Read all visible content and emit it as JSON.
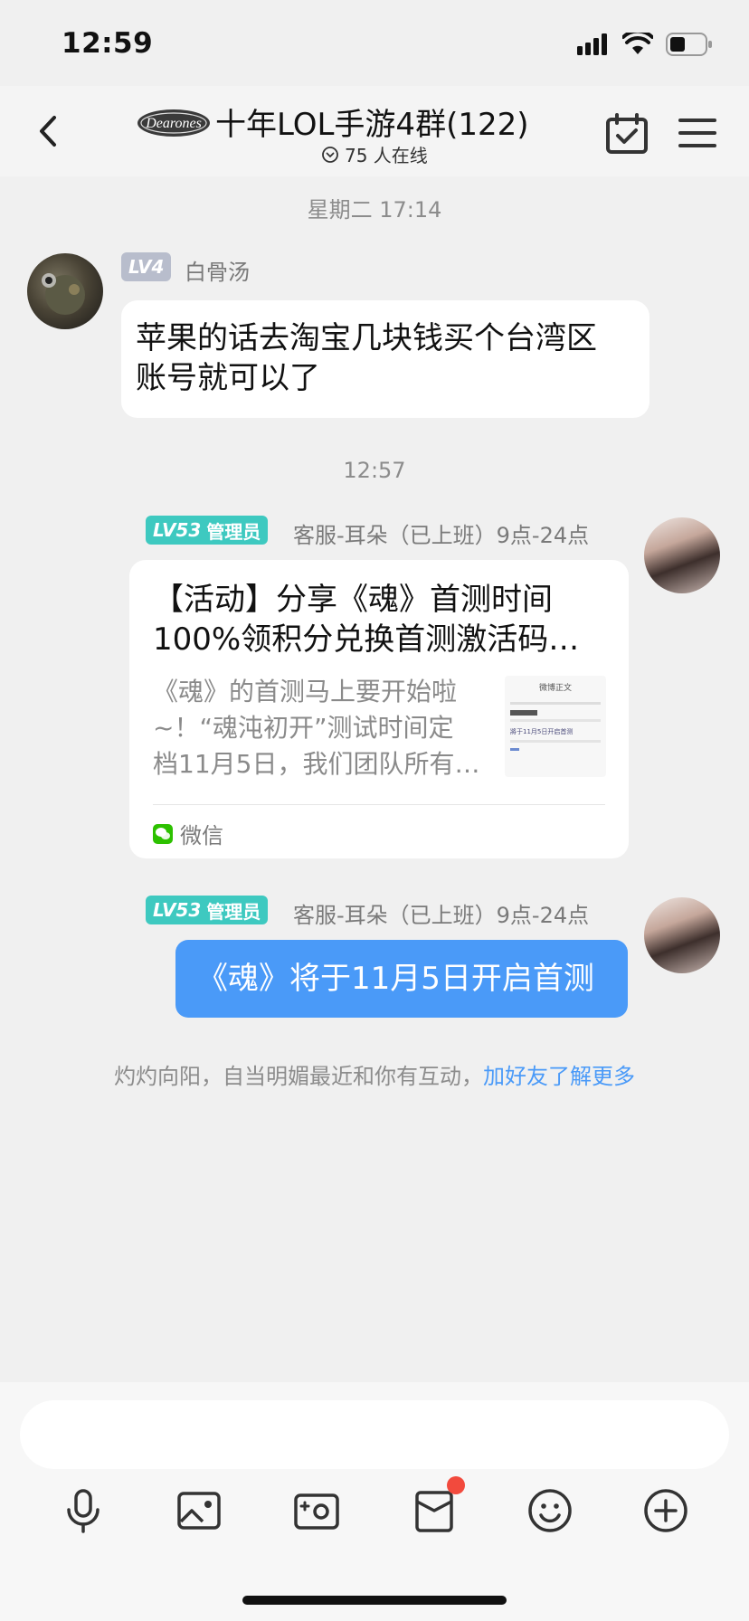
{
  "status_bar": {
    "time": "12:59"
  },
  "header": {
    "logo_text": "Dearones",
    "title": "十年LOL手游4群(122)",
    "online": "75 人在线"
  },
  "timestamps": [
    "星期二 17:14",
    "12:57"
  ],
  "messages": [
    {
      "level": "LV4",
      "sender": "白骨汤",
      "text_line1": "苹果的话去淘宝几块钱买个台湾区",
      "text_line2": "账号就可以了"
    },
    {
      "level": "LV53",
      "role": "管理员",
      "sender": "客服-耳朵（已上班）9点-24点",
      "card": {
        "title_line1": "【活动】分享《魂》首测时间",
        "title_line2": "100%领积分兑换首测激活码…",
        "desc_line1": "《魂》的首测马上要开始啦",
        "desc_line2": "~！“魂沌初开”测试时间定",
        "desc_line3": "档11月5日，我们团队所有…",
        "thumb_header": "微博正文",
        "thumb_line": "將于11月5日开启首测",
        "source": "微信"
      }
    },
    {
      "level": "LV53",
      "role": "管理员",
      "sender": "客服-耳朵（已上班）9点-24点",
      "text": "《魂》将于11月5日开启首测"
    }
  ],
  "notice": {
    "text": "灼灼向阳，自当明媚最近和你有互动，",
    "link": "加好友了解更多"
  },
  "colors": {
    "accent_blue": "#4a9af8",
    "admin_badge": "#3ec9c0",
    "level_gray": "#b8bdcc",
    "notification_red": "#f24a3d"
  },
  "toolbar_icons": [
    "microphone-icon",
    "picture-icon",
    "camera-icon",
    "red-packet-icon",
    "emoji-icon",
    "plus-icon"
  ]
}
